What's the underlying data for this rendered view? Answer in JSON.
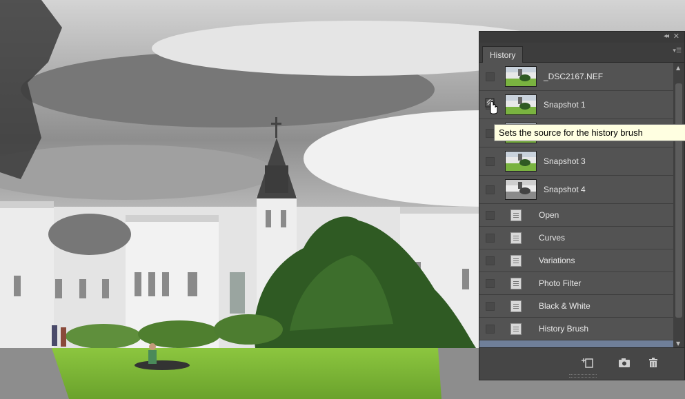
{
  "panel": {
    "tab_label": "History",
    "collapse_glyph": "◂◂",
    "close_glyph": "✕",
    "menu_glyph": "▾☰",
    "snapshots": [
      {
        "label": "_DSC2167.NEF",
        "thumb": "color"
      },
      {
        "label": "Snapshot 1",
        "thumb": "color"
      },
      {
        "label": "",
        "thumb": "color"
      },
      {
        "label": "Snapshot 3",
        "thumb": "color"
      },
      {
        "label": "Snapshot 4",
        "thumb": "bw"
      }
    ],
    "states": [
      {
        "label": "Open"
      },
      {
        "label": "Curves"
      },
      {
        "label": "Variations"
      },
      {
        "label": "Photo Filter"
      },
      {
        "label": "Black & White"
      },
      {
        "label": "History Brush"
      }
    ],
    "footer": {
      "new_document_icon": "new-document-from-state-icon",
      "snapshot_icon": "camera-icon",
      "delete_icon": "trash-icon"
    }
  },
  "tooltip": "Sets the source for the history brush",
  "colors": {
    "panel_bg": "#535353",
    "selected_row": "#6f7f99",
    "tooltip_bg": "#ffffe1",
    "grass": "#7fb33a"
  }
}
